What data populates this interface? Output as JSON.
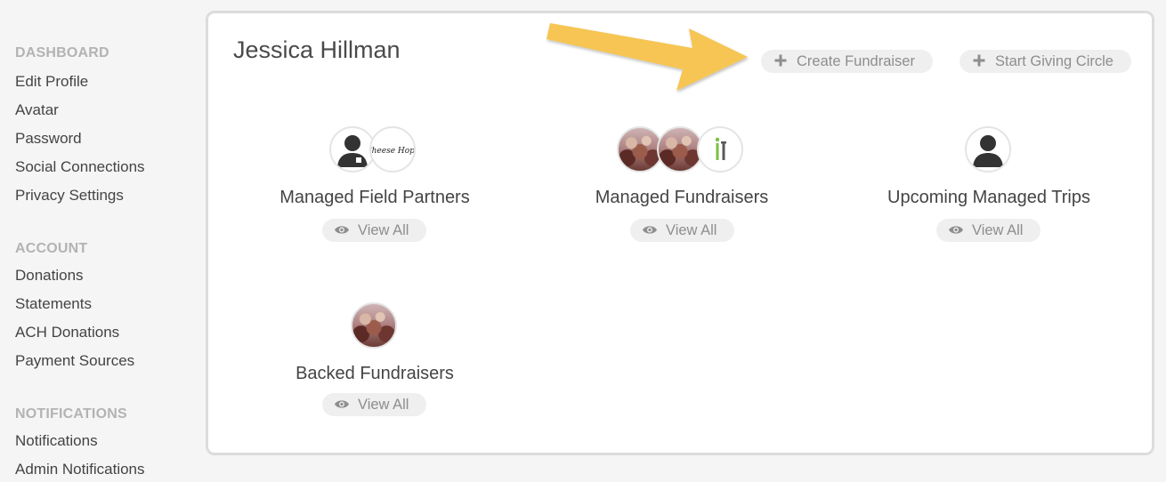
{
  "sidebar": {
    "sections": [
      {
        "heading": "DASHBOARD",
        "items": [
          "Edit Profile",
          "Avatar",
          "Password",
          "Social Connections",
          "Privacy Settings"
        ]
      },
      {
        "heading": "ACCOUNT",
        "items": [
          "Donations",
          "Statements",
          "ACH Donations",
          "Payment Sources"
        ]
      },
      {
        "heading": "NOTIFICATIONS",
        "items": [
          "Notifications",
          "Admin Notifications"
        ]
      }
    ]
  },
  "profile": {
    "name": "Jessica Hillman",
    "actions": {
      "create_fundraiser": "Create Fundraiser",
      "start_giving_circle": "Start Giving Circle"
    }
  },
  "sections": [
    {
      "title": "Managed Field Partners",
      "view_all": "View All",
      "avatars": [
        "person-icon",
        "cheese-logo"
      ],
      "logo_text": "Cheese Hope"
    },
    {
      "title": "Managed Fundraisers",
      "view_all": "View All",
      "avatars": [
        "crowd-photo",
        "crowd-photo",
        "fundraiser-logo"
      ]
    },
    {
      "title": "Upcoming Managed Trips",
      "view_all": "View All",
      "avatars": [
        "person-icon"
      ]
    },
    {
      "title": "Backed Fundraisers",
      "view_all": "View All",
      "avatars": [
        "crowd-photo"
      ]
    }
  ],
  "colors": {
    "arrow": "#f6c553",
    "pill_bg": "#efefef",
    "pill_text": "#8e8e8e",
    "logo_green": "#7bc043",
    "logo_gray": "#5a5a5a"
  }
}
